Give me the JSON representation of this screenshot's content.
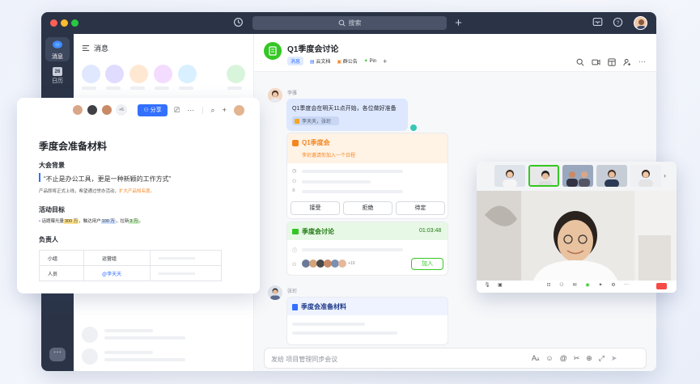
{
  "titlebar": {
    "search_placeholder": "搜索"
  },
  "rail": {
    "messages_label": "消息",
    "calendar_label": "日历",
    "calendar_day": "26"
  },
  "convlist": {
    "title": "消息"
  },
  "chat": {
    "title": "Q1季度会讨论",
    "tabs": [
      {
        "label": "消息"
      },
      {
        "label": "云文档"
      },
      {
        "label": "群公告"
      },
      {
        "label": "Pin"
      }
    ],
    "msg1": {
      "sender": "李雅",
      "text": "Q1季度会在明天11点开始，各位做好准备",
      "mention_text": "李天天，张珩"
    },
    "event_card": {
      "title": "Q1季度会",
      "subtitle": "李珩邀请你加入一个日程",
      "btn_accept": "接受",
      "btn_decline": "拒绝",
      "btn_pending": "待定"
    },
    "meeting_card": {
      "title": "季度会讨论",
      "duration": "01:03:48",
      "join_label": "加入",
      "extra_count": "+10"
    },
    "msg2": {
      "sender": "张珩",
      "doc_title": "季度会准备材料"
    },
    "input_placeholder": "发给 项目管理同步会议"
  },
  "doc": {
    "share_label": "分享",
    "extra_count": "+6",
    "title": "季度会准备材料",
    "section1": "大会背景",
    "quote": "“不止是办公工具，更是一种新颖的工作方式”",
    "line1_pre": "产品即将正式上线，希望通过举办活动，",
    "line1_hl": "扩大产品知名度。",
    "section2": "活动目标",
    "goal_parts": [
      "话题曝光量",
      "300 万",
      "，触达用户",
      "100 万",
      "，拉新",
      "3 万",
      "。"
    ],
    "section3": "负责人",
    "table": [
      [
        "小组",
        "运营组",
        ""
      ],
      [
        "人员",
        "@李天天",
        ""
      ]
    ]
  },
  "colors": {
    "accent": "#3370ff",
    "titlebar": "#2b3447",
    "chat_green": "#34c724",
    "orange": "#f5851f"
  }
}
